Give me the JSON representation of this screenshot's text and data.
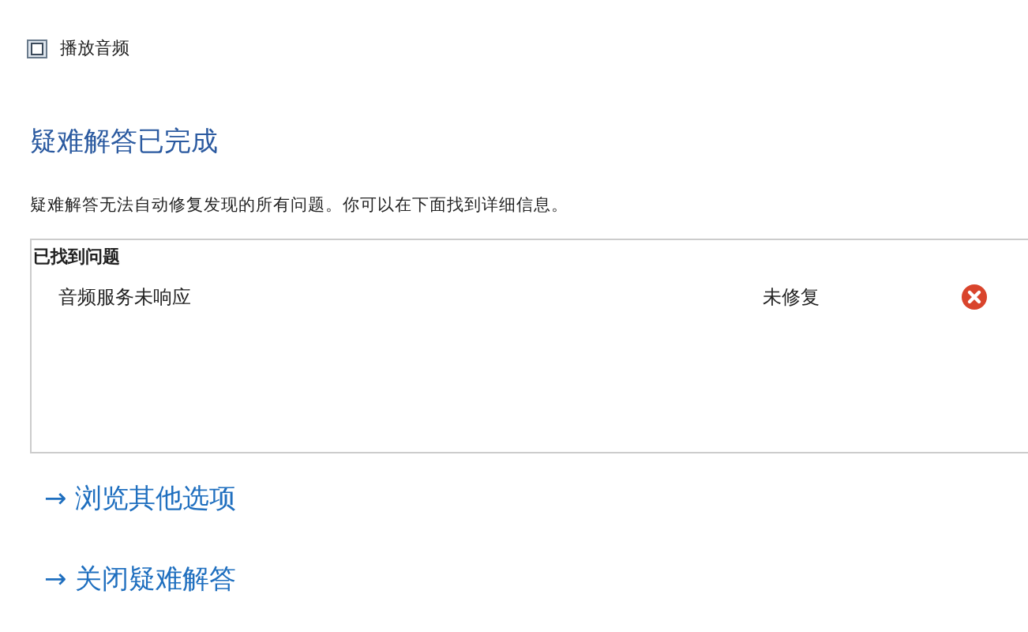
{
  "window": {
    "title": "播放音频"
  },
  "heading": "疑难解答已完成",
  "description": "疑难解答无法自动修复发现的所有问题。你可以在下面找到详细信息。",
  "problems": {
    "title": "已找到问题",
    "items": [
      {
        "name": "音频服务未响应",
        "status": "未修复",
        "kind": "not-fixed"
      }
    ]
  },
  "links": [
    {
      "arrow": "→",
      "label": "浏览其他选项"
    },
    {
      "arrow": "→",
      "label": "关闭疑难解答"
    }
  ]
}
